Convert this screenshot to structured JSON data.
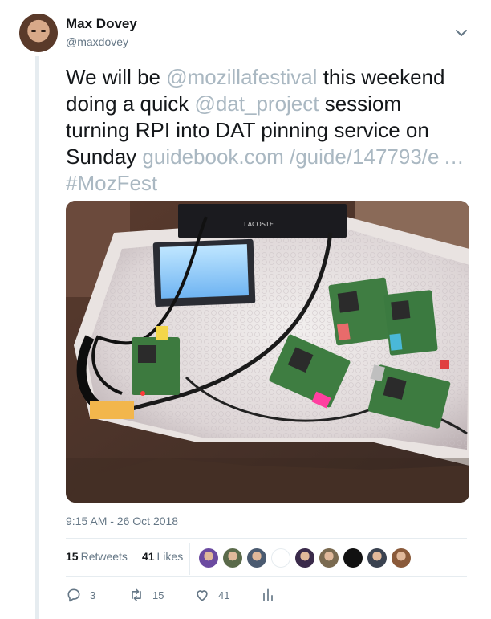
{
  "author": {
    "name": "Max Dovey",
    "handle": "@maxdovey"
  },
  "tweet": {
    "t1": "We will be ",
    "mention1": "@mozillafestival",
    "t2": " this weekend doing a quick ",
    "mention2": "@dat_project",
    "t3": " sessiom turning RPI into DAT pinning service on Sunday ",
    "link": "guidebook.com /guide/147793/e …",
    "t4": " ",
    "hashtag": "#MozFest"
  },
  "photo": {
    "box_label": "LACOSTE"
  },
  "timestamp": "9:15 AM - 26 Oct 2018",
  "stats": {
    "retweets_count": "15",
    "retweets_label": "Retweets",
    "likes_count": "41",
    "likes_label": "Likes"
  },
  "liker_avatar_colors": [
    "#6b4aa0",
    "#5a6a4a",
    "#4a5a70",
    "#ffffff",
    "#3a2a4a",
    "#7a6a50",
    "#111111",
    "#3a4250",
    "#8a5a3a"
  ],
  "actions": {
    "reply_count": "3",
    "retweet_count": "15",
    "like_count": "41"
  },
  "colors": {
    "link": "#aab8c2",
    "muted": "#657786",
    "text": "#14171a"
  }
}
